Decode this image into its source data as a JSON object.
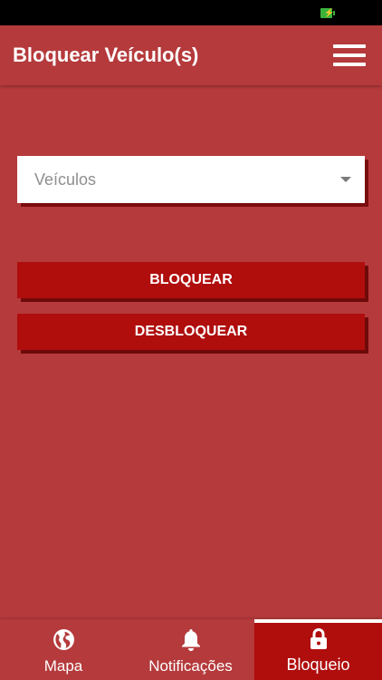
{
  "app_bar": {
    "title": "Bloquear Veículo(s)",
    "menu_icon": "hamburger-menu-icon"
  },
  "form": {
    "vehicle_select": {
      "placeholder": "Veículos",
      "value": ""
    },
    "block_button": "BLOQUEAR",
    "unblock_button": "DESBLOQUEAR"
  },
  "bottom_nav": {
    "items": [
      {
        "label": "Mapa",
        "icon": "globe-icon",
        "active": false
      },
      {
        "label": "Notificações",
        "icon": "bell-icon",
        "active": false
      },
      {
        "label": "Bloqueio",
        "icon": "lock-icon",
        "active": true
      }
    ]
  },
  "colors": {
    "background": "#b53a3c",
    "accent": "#b00d0d",
    "button_shadow": "#6e0a0a",
    "status_bar": "#000000",
    "battery": "#3bb33b"
  }
}
